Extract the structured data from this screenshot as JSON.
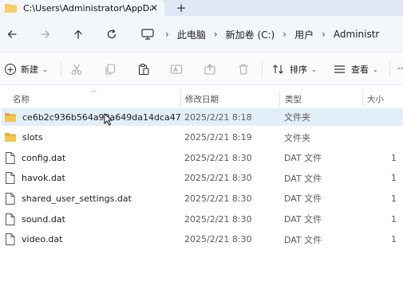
{
  "tab": {
    "title": "C:\\Users\\Administrator\\AppDa",
    "close": "✕",
    "new": "+"
  },
  "nav": {
    "back": "back",
    "forward": "forward",
    "up": "up",
    "refresh": "refresh",
    "breadcrumbs": [
      "此电脑",
      "新加卷 (C:)",
      "用户",
      "Administr"
    ],
    "separator": "›"
  },
  "commands": {
    "new_label": "新建",
    "sort_label": "排序",
    "view_label": "查看",
    "more": "···",
    "icons": [
      "cut-icon",
      "copy-icon",
      "paste-icon",
      "rename-icon",
      "share-icon",
      "delete-icon"
    ]
  },
  "columns": {
    "name": "名称",
    "date": "修改日期",
    "type": "类型",
    "size": "大小"
  },
  "files": [
    {
      "name": "ce6b2c936b564a90a649da14dca47...",
      "date": "2025/2/21 8:18",
      "type": "文件夹",
      "size": "",
      "kind": "folder",
      "selected": true
    },
    {
      "name": "slots",
      "date": "2025/2/21 8:19",
      "type": "文件夹",
      "size": "",
      "kind": "folder",
      "selected": false
    },
    {
      "name": "config.dat",
      "date": "2025/2/21 8:30",
      "type": "DAT 文件",
      "size": "1",
      "kind": "file",
      "selected": false
    },
    {
      "name": "havok.dat",
      "date": "2025/2/21 8:30",
      "type": "DAT 文件",
      "size": "1",
      "kind": "file",
      "selected": false
    },
    {
      "name": "shared_user_settings.dat",
      "date": "2025/2/21 8:30",
      "type": "DAT 文件",
      "size": "1",
      "kind": "file",
      "selected": false
    },
    {
      "name": "sound.dat",
      "date": "2025/2/21 8:30",
      "type": "DAT 文件",
      "size": "1",
      "kind": "file",
      "selected": false
    },
    {
      "name": "video.dat",
      "date": "2025/2/21 8:30",
      "type": "DAT 文件",
      "size": "1",
      "kind": "file",
      "selected": false
    }
  ],
  "colors": {
    "folder": "#f4c64a",
    "folder_dark": "#e0a92a",
    "selection": "#e3eefb",
    "tabbar": "#dfe8f3"
  }
}
